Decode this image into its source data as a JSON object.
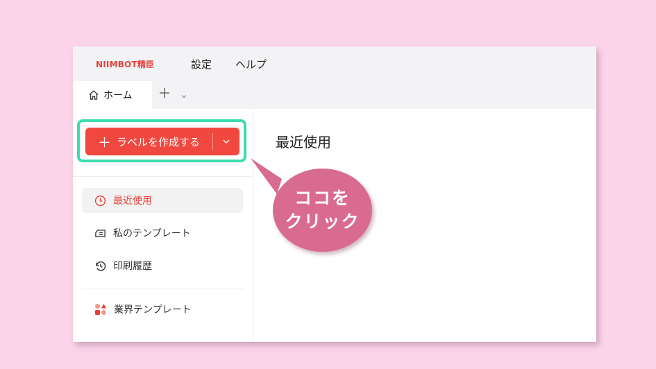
{
  "app": {
    "brand": "NIIMBOT精臣",
    "menu": [
      "設定",
      "ヘルプ"
    ]
  },
  "tabs": {
    "home_label": "ホーム",
    "add_icon": "plus-icon"
  },
  "sidebar": {
    "create_label": "ラベルを作成する",
    "items": [
      {
        "label": "最近使用",
        "icon": "clock-icon",
        "active": true
      },
      {
        "label": "私のテンプレート",
        "icon": "template-icon"
      },
      {
        "label": "印刷履歴",
        "icon": "history-icon"
      },
      {
        "label": "業界テンプレート",
        "icon": "shapes-icon"
      }
    ]
  },
  "main": {
    "title": "最近使用"
  },
  "annotation": {
    "line1": "ココを",
    "line2": "クリック"
  },
  "colors": {
    "background": "#fcd4ea",
    "accent": "#f0473f",
    "highlight": "#3ddbb0",
    "bubble": "#d96a90"
  }
}
